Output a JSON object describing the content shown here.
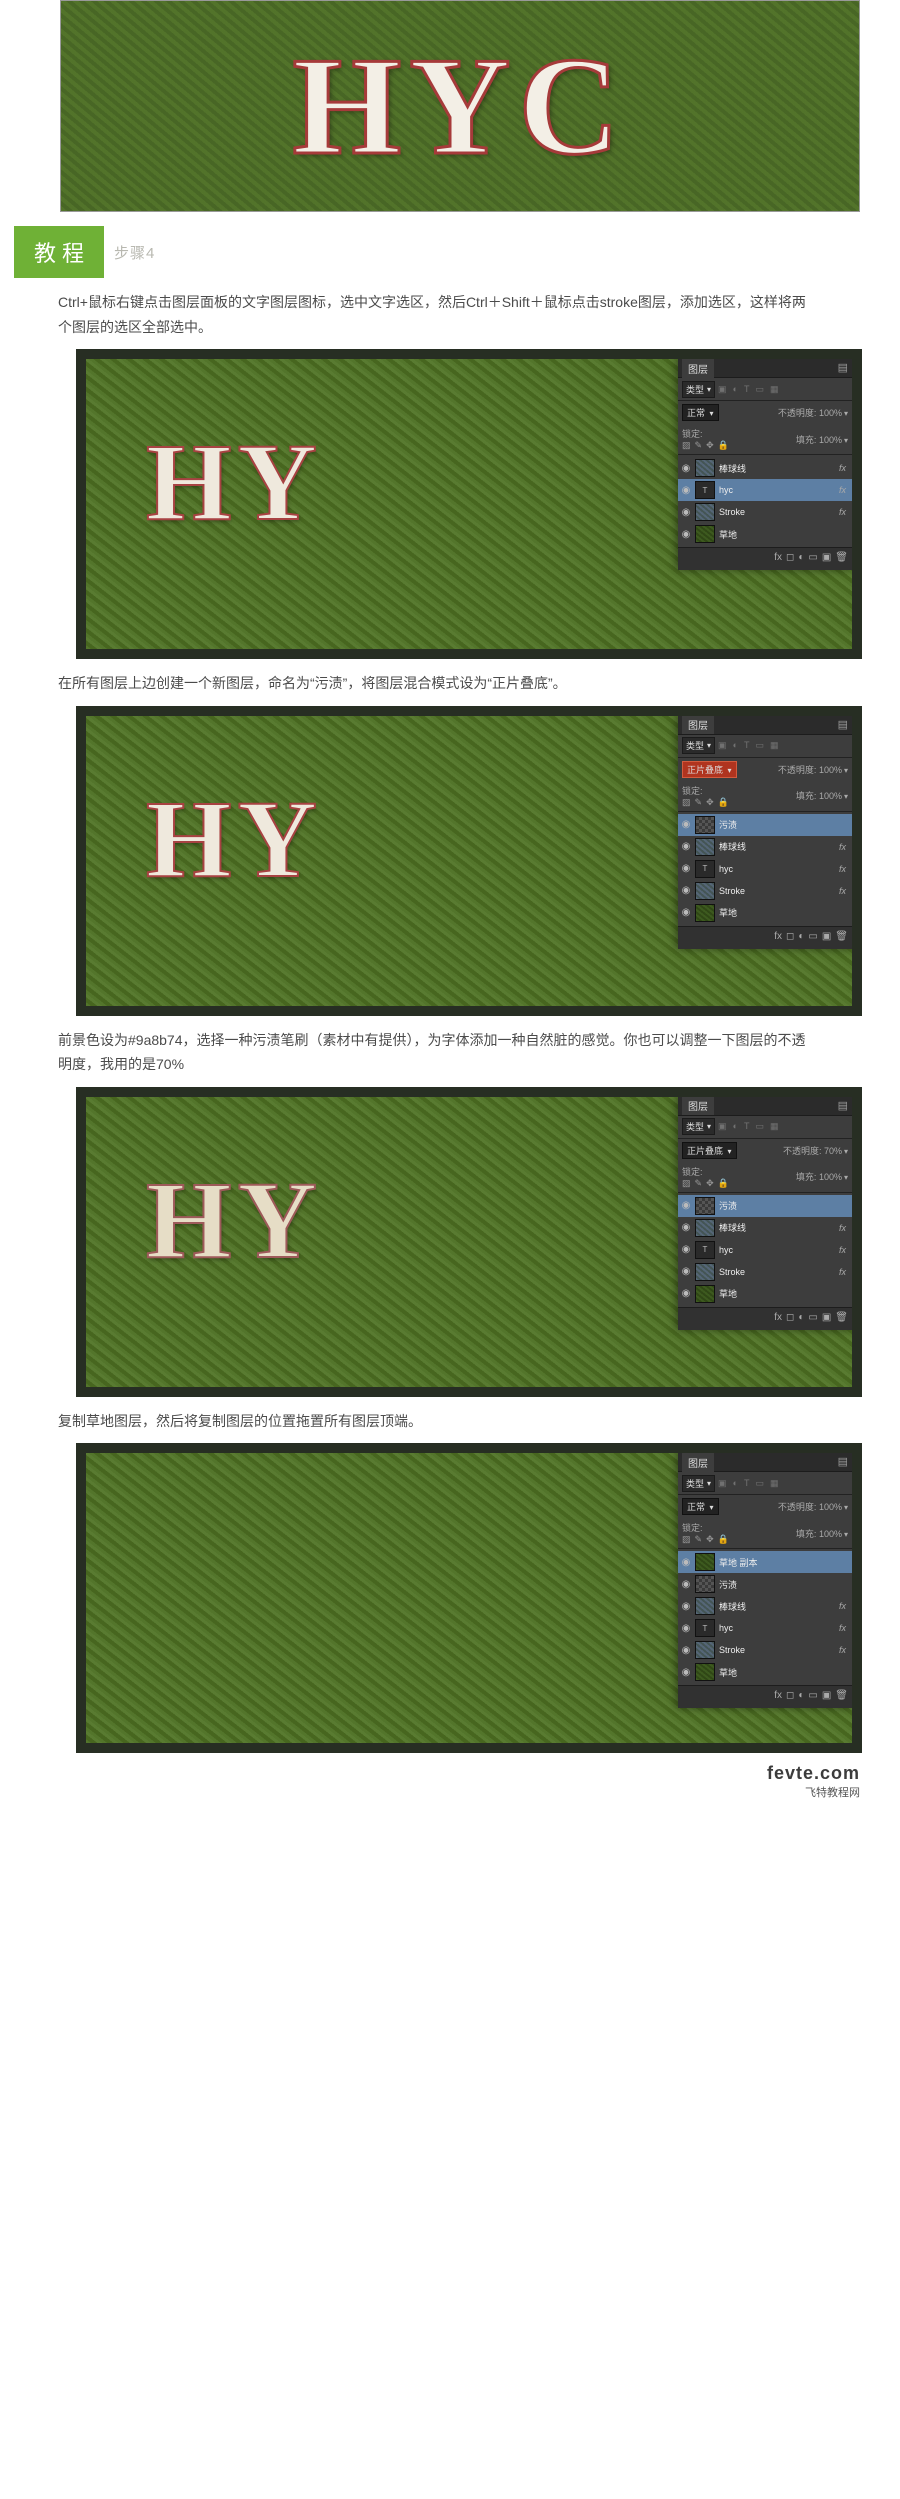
{
  "hero": {
    "text": "HYC"
  },
  "sectionHead": {
    "green": "教程",
    "gray": "步骤4"
  },
  "steps": {
    "a": "Ctrl+鼠标右键点击图层面板的文字图层图标，选中文字选区，然后Ctrl＋Shift＋鼠标点击stroke图层，添加选区，这样将两个图层的选区全部选中。",
    "b": "在所有图层上边创建一个新图层，命名为“污渍”，将图层混合模式设为“正片叠底”。",
    "c": "前景色设为#9a8b74，选择一种污渍笔刷（素材中有提供），为字体添加一种自然脏的感觉。你也可以调整一下图层的不透明度，我用的是70%",
    "d": "复制草地图层，然后将复制图层的位置拖置所有图层顶端。"
  },
  "figText": {
    "hy": "HY"
  },
  "layersPanel": {
    "tab": "图层",
    "filterLabel": "类型",
    "blendNormal": "正常",
    "blendMultiply": "正片叠底",
    "opacityLabel": "不透明度:",
    "opacity100": "100%",
    "opacity70": "70%",
    "lockLabel": "锁定:",
    "fillLabel": "填充:",
    "fxLabel": "fx",
    "layers_a": [
      {
        "name": "棒球线",
        "thumb": "image",
        "fx": true
      },
      {
        "name": "hyc",
        "thumb": "text",
        "fx": true,
        "sel": true
      },
      {
        "name": "Stroke",
        "thumb": "image",
        "fx": true
      },
      {
        "name": "草地",
        "thumb": "grass"
      }
    ],
    "layers_b": [
      {
        "name": "污渍",
        "thumb": "checker",
        "sel": true
      },
      {
        "name": "棒球线",
        "thumb": "image",
        "fx": true
      },
      {
        "name": "hyc",
        "thumb": "text",
        "fx": true
      },
      {
        "name": "Stroke",
        "thumb": "image",
        "fx": true
      },
      {
        "name": "草地",
        "thumb": "grass"
      }
    ],
    "layers_c": [
      {
        "name": "污渍",
        "thumb": "checker",
        "sel": true
      },
      {
        "name": "棒球线",
        "thumb": "image",
        "fx": true
      },
      {
        "name": "hyc",
        "thumb": "text",
        "fx": true
      },
      {
        "name": "Stroke",
        "thumb": "image",
        "fx": true
      },
      {
        "name": "草地",
        "thumb": "grass"
      }
    ],
    "layers_d": [
      {
        "name": "草地 副本",
        "thumb": "grass",
        "sel": true
      },
      {
        "name": "污渍",
        "thumb": "checker"
      },
      {
        "name": "棒球线",
        "thumb": "image",
        "fx": true
      },
      {
        "name": "hyc",
        "thumb": "text",
        "fx": true
      },
      {
        "name": "Stroke",
        "thumb": "image",
        "fx": true
      },
      {
        "name": "草地",
        "thumb": "grass"
      }
    ]
  },
  "footer": {
    "big": "fevte.com",
    "small": "飞特教程网"
  }
}
